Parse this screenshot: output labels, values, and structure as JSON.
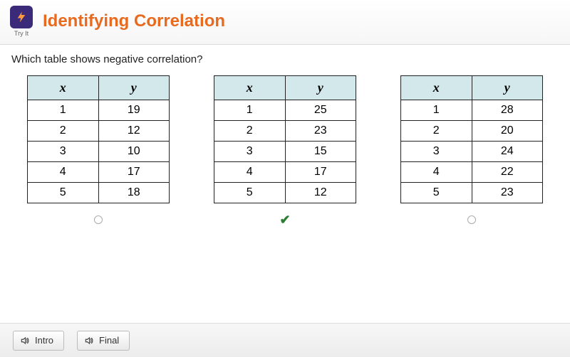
{
  "header": {
    "tryit_label": "Try It",
    "title": "Identifying Correlation"
  },
  "question": "Which table shows negative correlation?",
  "columns": {
    "x": "x",
    "y": "y"
  },
  "tables": [
    {
      "rows": [
        [
          1,
          19
        ],
        [
          2,
          12
        ],
        [
          3,
          10
        ],
        [
          4,
          17
        ],
        [
          5,
          18
        ]
      ],
      "selected": false
    },
    {
      "rows": [
        [
          1,
          25
        ],
        [
          2,
          23
        ],
        [
          3,
          15
        ],
        [
          4,
          17
        ],
        [
          5,
          12
        ]
      ],
      "selected": true
    },
    {
      "rows": [
        [
          1,
          28
        ],
        [
          2,
          20
        ],
        [
          3,
          24
        ],
        [
          4,
          22
        ],
        [
          5,
          23
        ]
      ],
      "selected": false
    }
  ],
  "footer": {
    "intro_label": "Intro",
    "final_label": "Final"
  }
}
